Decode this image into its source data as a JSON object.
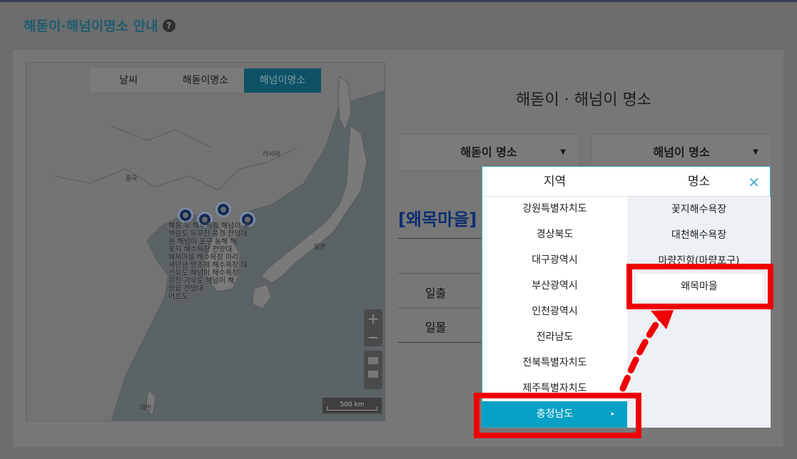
{
  "page": {
    "title": "해돋이·해넘이명소 안내",
    "help_icon": "?"
  },
  "map": {
    "tabs": [
      {
        "label": "날씨",
        "active": false
      },
      {
        "label": "해돋이명소",
        "active": false
      },
      {
        "label": "해넘이명소",
        "active": true
      }
    ],
    "labels": {
      "russia": "러시아",
      "china": "중국",
      "japan": "일본",
      "taiwan": "대만"
    },
    "poi_text": [
      "해동 두 해수욕장 해넘이 동",
      "백령도 두무진 풍경 전망대",
      "용 해넘이 포구 동해 해",
      "꽃지 해수욕장 전망대",
      "왜목마을 해수욕장 마리",
      "새만금 방조제 해수욕장 대",
      "선유도 해넘이 해수욕장",
      "강진 가우도 해넘이 해",
      "땅끝 전망대",
      "어르도"
    ],
    "zoom_in": "+",
    "zoom_out": "−",
    "scale_label": "500 km"
  },
  "content": {
    "heading": "해돋이 · 해넘이 명소",
    "dropdown_sunrise": "해돋이 명소",
    "dropdown_sunset": "해넘이 명소",
    "dropdown_arrow": "▼",
    "place_title": "[왜목마을]",
    "rows": [
      "일출",
      "일몰"
    ]
  },
  "popup": {
    "region_header": "지역",
    "place_header": "명소",
    "close_icon": "✕",
    "regions": [
      "강원특별자치도",
      "경상북도",
      "대구광역시",
      "부산광역시",
      "인천광역시",
      "전라남도",
      "전북특별자치도",
      "제주특별자치도",
      "충청남도"
    ],
    "selected_region": "충청남도",
    "selected_arrow": "▸",
    "places": [
      "꽃지해수욕장",
      "대천해수욕장",
      "마량진항(마량포구)",
      "왜목마을"
    ],
    "selected_place": "왜목마을"
  },
  "colors": {
    "accent": "#06a1c4",
    "annotation_red": "#f00000",
    "title_blue": "#0c2f72"
  }
}
